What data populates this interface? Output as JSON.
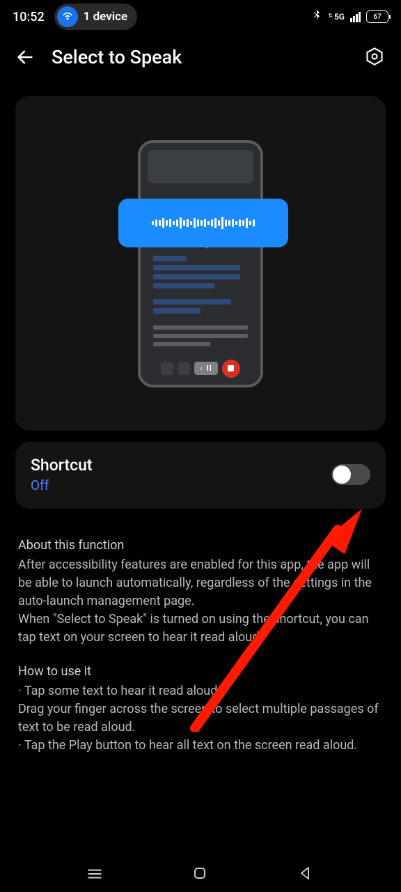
{
  "status": {
    "time": "10:52",
    "device_pill": "1 device",
    "network_label": "5G",
    "battery_pct": "67"
  },
  "header": {
    "title": "Select to Speak"
  },
  "shortcut": {
    "title": "Shortcut",
    "state": "Off"
  },
  "about": {
    "heading": "About this function",
    "body1": "After accessibility features are enabled for this app, the app will be able to launch automatically, regardless of the settings in the auto-launch management page.",
    "body2": "When \"Select to Speak\" is turned on using the shortcut, you can tap text on your screen to hear it read aloud."
  },
  "howto": {
    "heading": "How to use it",
    "item1": "· Tap some text to hear it read aloud.",
    "item2": "Drag your finger across the screen to select multiple passages of text to be read aloud.",
    "item3": "· Tap the Play button to hear all text on the screen read aloud."
  }
}
